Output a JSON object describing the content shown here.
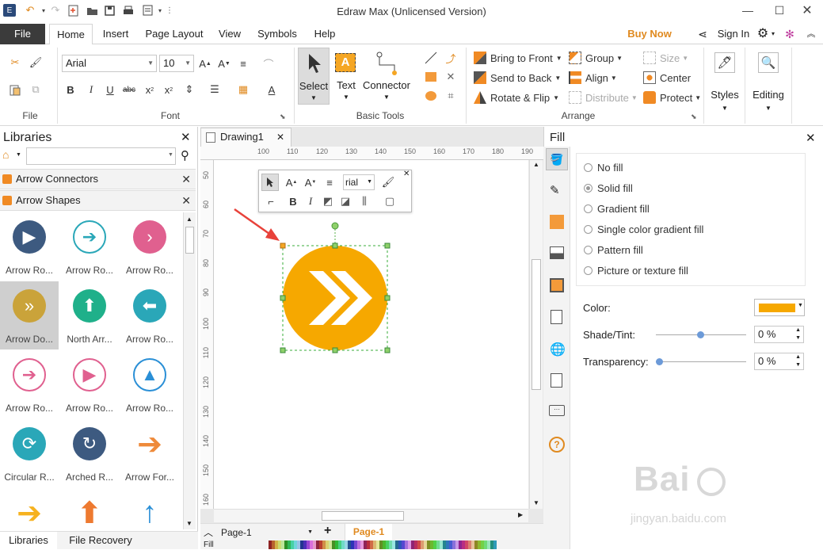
{
  "app": {
    "title": "Edraw Max (Unlicensed Version)"
  },
  "menu": {
    "tabs": [
      "File",
      "Home",
      "Insert",
      "Page Layout",
      "View",
      "Symbols",
      "Help"
    ],
    "buy_now": "Buy Now",
    "sign_in": "Sign In"
  },
  "ribbon": {
    "font_name": "Arial",
    "font_size": "10",
    "tools": {
      "select": "Select",
      "text": "Text",
      "connector": "Connector"
    },
    "arrange": {
      "bring_to_front": "Bring to Front",
      "send_to_back": "Send to Back",
      "rotate_flip": "Rotate & Flip",
      "group": "Group",
      "align": "Align",
      "distribute": "Distribute",
      "size": "Size",
      "center": "Center",
      "protect": "Protect"
    },
    "styles": "Styles",
    "editing": "Editing",
    "groups": {
      "file": "File",
      "font": "Font",
      "basic_tools": "Basic Tools",
      "arrange": "Arrange"
    }
  },
  "libraries": {
    "title": "Libraries",
    "search_placeholder": "",
    "categories": [
      "Arrow Connectors",
      "Arrow Shapes"
    ],
    "shapes": [
      {
        "label": "Arrow Ro...",
        "color": "#3d5a80",
        "glyph": "▶",
        "style": "solid"
      },
      {
        "label": "Arrow Ro...",
        "color": "#2aa7b8",
        "glyph": "➔",
        "style": "ring"
      },
      {
        "label": "Arrow Ro...",
        "color": "#e0608f",
        "glyph": "›",
        "style": "solid"
      },
      {
        "label": "Arrow Do...",
        "color": "#caa33a",
        "glyph": "»",
        "style": "solid"
      },
      {
        "label": "North Arr...",
        "color": "#1fb08a",
        "glyph": "⬆",
        "style": "solid"
      },
      {
        "label": "Arrow Ro...",
        "color": "#2aa7b8",
        "glyph": "⬅",
        "style": "solid"
      },
      {
        "label": "Arrow Ro...",
        "color": "#e0608f",
        "glyph": "➔",
        "style": "ring"
      },
      {
        "label": "Arrow Ro...",
        "color": "#e0608f",
        "glyph": "▶",
        "style": "ring"
      },
      {
        "label": "Arrow Ro...",
        "color": "#2a8fd6",
        "glyph": "▲",
        "style": "ring"
      },
      {
        "label": "Circular R...",
        "color": "#2aa7b8",
        "glyph": "⟳",
        "style": "solid"
      },
      {
        "label": "Arched R...",
        "color": "#3d5a80",
        "glyph": "↻",
        "style": "solid"
      },
      {
        "label": "Arrow For...",
        "color": "#ee8a3a",
        "glyph": "➔",
        "style": "plain"
      },
      {
        "label": "",
        "color": "#f6b220",
        "glyph": "➔",
        "style": "plain"
      },
      {
        "label": "",
        "color": "#ee7a30",
        "glyph": "⬆",
        "style": "plain"
      },
      {
        "label": "",
        "color": "#2a8fd6",
        "glyph": "↑",
        "style": "plain"
      }
    ],
    "bottom_tabs": [
      "Libraries",
      "File Recovery"
    ]
  },
  "document": {
    "tab": "Drawing1",
    "ruler_h": [
      "100",
      "110",
      "120",
      "130",
      "140",
      "150",
      "160",
      "170",
      "180",
      "190"
    ],
    "ruler_v": [
      "50",
      "60",
      "70",
      "80",
      "90",
      "100",
      "110",
      "120",
      "130",
      "140",
      "150",
      "160"
    ],
    "mini_font": "rial",
    "page_name": "Page-1",
    "page_tab": "Page-1",
    "fill_label": "Fill",
    "shape_color": "#f6a800"
  },
  "fill_panel": {
    "title": "Fill",
    "options": [
      {
        "label": "No fill",
        "selected": false
      },
      {
        "label": "Solid fill",
        "selected": true
      },
      {
        "label": "Gradient fill",
        "selected": false
      },
      {
        "label": "Single color gradient fill",
        "selected": false
      },
      {
        "label": "Pattern fill",
        "selected": false
      },
      {
        "label": "Picture or texture fill",
        "selected": false
      }
    ],
    "color_label": "Color:",
    "color_value": "#f6a800",
    "shade_label": "Shade/Tint:",
    "shade_value": "0 %",
    "transparency_label": "Transparency:",
    "transparency_value": "0 %"
  },
  "watermark": {
    "line1": "Bai",
    "line2": "jingyan.baidu.com"
  }
}
